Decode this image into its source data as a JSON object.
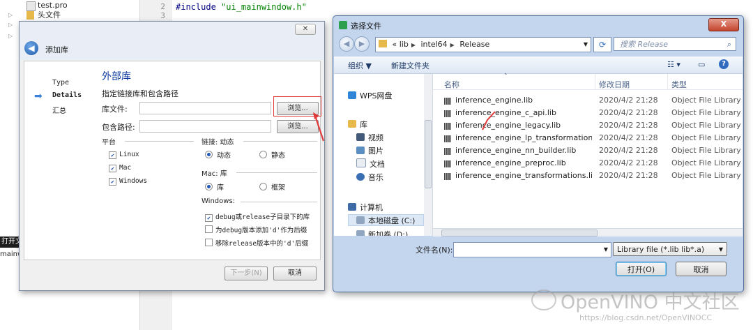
{
  "ide": {
    "tree": [
      {
        "label": "test.pro"
      },
      {
        "label": "头文件"
      }
    ],
    "line_numbers": [
      "2",
      "3"
    ],
    "code": {
      "keyword": "#include",
      "string": "\"ui_mainwindow.h\""
    },
    "output_tab_label": "打开文",
    "output_line": "mainw"
  },
  "wizard": {
    "window_title": "添加库",
    "close_glyph": "✕",
    "steps": [
      {
        "label": "Type"
      },
      {
        "label": "Details"
      },
      {
        "label": "汇总"
      }
    ],
    "heading": "外部库",
    "subtitle": "指定链接库和包含路径",
    "library_file_label": "库文件:",
    "library_file_value": "",
    "include_path_label": "包含路径:",
    "include_path_value": "",
    "browse_label": "浏览...",
    "platform": {
      "title": "平台",
      "items": [
        {
          "label": "Linux",
          "checked": true
        },
        {
          "label": "Mac",
          "checked": true
        },
        {
          "label": "Windows",
          "checked": true
        }
      ]
    },
    "linkage": {
      "title": "链接: 动态",
      "dynamic_label": "动态",
      "static_label": "静态"
    },
    "mac": {
      "title": "Mac: 库",
      "library_label": "库",
      "framework_label": "框架"
    },
    "windows": {
      "title": "Windows:",
      "opt1": "debug或release子目录下的库",
      "opt2": "为debug版本添加'd'作为后缀",
      "opt3": "移除release版本中的'd'后缀"
    },
    "next_label": "下一步(N)",
    "cancel_label": "取消"
  },
  "file_dialog": {
    "title": "选择文件",
    "close_glyph": "X",
    "breadcrumb": [
      "«",
      "lib",
      "intel64",
      "Release"
    ],
    "search_placeholder": "搜索 Release",
    "organize_label": "组织 ▼",
    "new_folder_label": "新建文件夹",
    "nav": [
      {
        "label": "WPS网盘",
        "icon": "cloud-icon"
      },
      {
        "label": "库",
        "icon": "library-icon"
      },
      {
        "label": "视频",
        "icon": "video-icon"
      },
      {
        "label": "图片",
        "icon": "picture-icon"
      },
      {
        "label": "文档",
        "icon": "document-icon"
      },
      {
        "label": "音乐",
        "icon": "music-icon"
      },
      {
        "label": "计算机",
        "icon": "computer-icon"
      },
      {
        "label": "本地磁盘 (C:)",
        "icon": "drive-icon"
      },
      {
        "label": "新加卷 (D:)",
        "icon": "drive-icon"
      }
    ],
    "columns": {
      "name": "名称",
      "date": "修改日期",
      "type": "类型"
    },
    "files": [
      {
        "name": "inference_engine.lib",
        "date": "2020/4/2 21:28",
        "type": "Object File Library"
      },
      {
        "name": "inference_engine_c_api.lib",
        "date": "2020/4/2 21:28",
        "type": "Object File Library"
      },
      {
        "name": "inference_engine_legacy.lib",
        "date": "2020/4/2 21:28",
        "type": "Object File Library"
      },
      {
        "name": "inference_engine_lp_transformations.l...",
        "date": "2020/4/2 21:28",
        "type": "Object File Library"
      },
      {
        "name": "inference_engine_nn_builder.lib",
        "date": "2020/4/2 21:28",
        "type": "Object File Library"
      },
      {
        "name": "inference_engine_preproc.lib",
        "date": "2020/4/2 21:28",
        "type": "Object File Library"
      },
      {
        "name": "inference_engine_transformations.lib",
        "date": "2020/4/2 21:28",
        "type": "Object File Library"
      }
    ],
    "filename_label": "文件名(N):",
    "filename_value": "",
    "filter_value": "Library file (*.lib lib*.a)",
    "open_label": "打开(O)",
    "cancel_label": "取消"
  },
  "watermark": {
    "logo_text": "OpenVINO 中文社区",
    "url": "https://blog.csdn.net/OpenVINOCC"
  },
  "colors": {
    "accent": "#0b3a9e",
    "highlight_red": "#e03a3a"
  }
}
